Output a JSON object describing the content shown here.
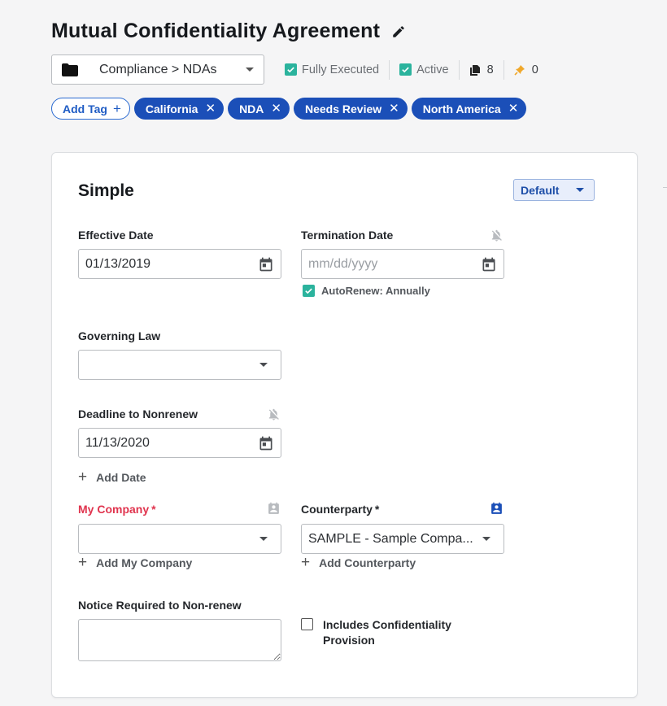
{
  "document": {
    "title": "Mutual Confidentiality Agreement"
  },
  "meta": {
    "folder_path": "Compliance > NDAs",
    "fully_executed": {
      "label": "Fully Executed",
      "checked": true
    },
    "active": {
      "label": "Active",
      "checked": true
    },
    "pages_count": "8",
    "pins_count": "0",
    "accent_color": "#2bb39d"
  },
  "tags": {
    "add_label": "Add Tag",
    "items": [
      {
        "label": "California"
      },
      {
        "label": "NDA"
      },
      {
        "label": "Needs Review"
      },
      {
        "label": "North America"
      }
    ],
    "tag_color": "#1b4fb8"
  },
  "form": {
    "section_title": "Simple",
    "view_select": "Default",
    "effective_date": {
      "label": "Effective Date",
      "value": "01/13/2019"
    },
    "termination_date": {
      "label": "Termination Date",
      "placeholder": "mm/dd/yyyy",
      "autorenew_label": "AutoRenew: Annually",
      "autorenew_checked": true
    },
    "governing_law": {
      "label": "Governing Law",
      "value": ""
    },
    "deadline_nonrenew": {
      "label": "Deadline to Nonrenew",
      "value": "11/13/2020"
    },
    "add_date_label": "Add Date",
    "my_company": {
      "label": "My Company",
      "required_mark": "*",
      "value": "",
      "add_label": "Add My Company"
    },
    "counterparty": {
      "label": "Counterparty",
      "required_mark": "*",
      "value": "SAMPLE - Sample Compa...",
      "add_label": "Add Counterparty"
    },
    "notice_required": {
      "label": "Notice Required to Non-renew",
      "value": ""
    },
    "includes_confidentiality": {
      "label_line1": "Includes Confidentiality",
      "label_line2": "Provision",
      "checked": false
    }
  }
}
